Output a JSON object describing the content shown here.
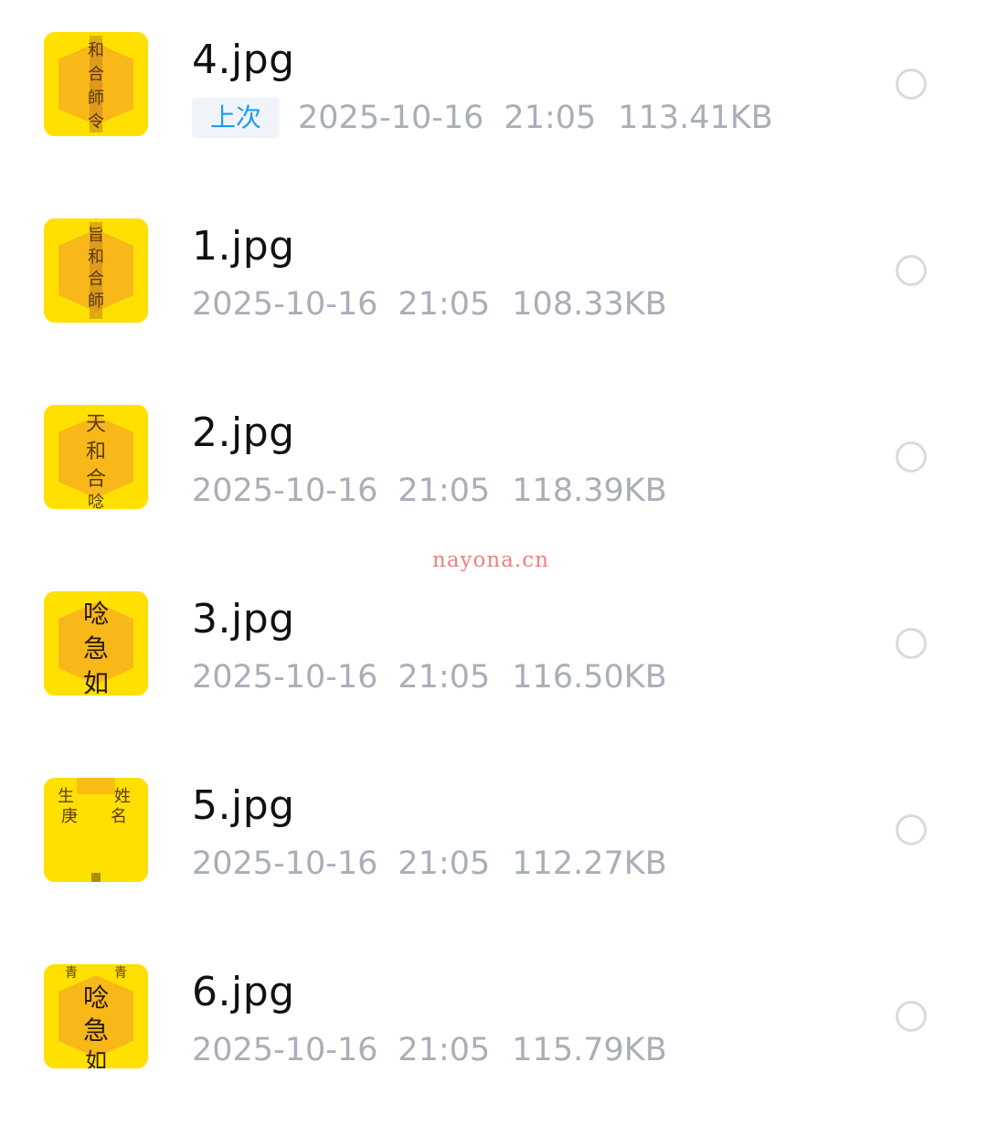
{
  "files": [
    {
      "name": "4.jpg",
      "badge": "上次",
      "date": "2025-10-16",
      "time": "21:05",
      "size": "113.41KB",
      "thumbnail": "yellow-talisman-thumbnail"
    },
    {
      "name": "1.jpg",
      "date": "2025-10-16",
      "time": "21:05",
      "size": "108.33KB",
      "thumbnail": "yellow-talisman-thumbnail"
    },
    {
      "name": "2.jpg",
      "date": "2025-10-16",
      "time": "21:05",
      "size": "118.39KB",
      "thumbnail": "yellow-talisman-thumbnail"
    },
    {
      "name": "3.jpg",
      "date": "2025-10-16",
      "time": "21:05",
      "size": "116.50KB",
      "thumbnail": "yellow-talisman-thumbnail"
    },
    {
      "name": "5.jpg",
      "date": "2025-10-16",
      "time": "21:05",
      "size": "112.27KB",
      "thumbnail": "yellow-talisman-thumbnail"
    },
    {
      "name": "6.jpg",
      "date": "2025-10-16",
      "time": "21:05",
      "size": "115.79KB",
      "thumbnail": "yellow-talisman-thumbnail"
    }
  ],
  "watermark": "nayona.cn",
  "colors": {
    "thumbnail_bg": "#FFE000",
    "badge_text": "#1C9CF0",
    "meta_text": "#A9AEB8",
    "name_text": "#111111",
    "watermark": "#F08080"
  }
}
